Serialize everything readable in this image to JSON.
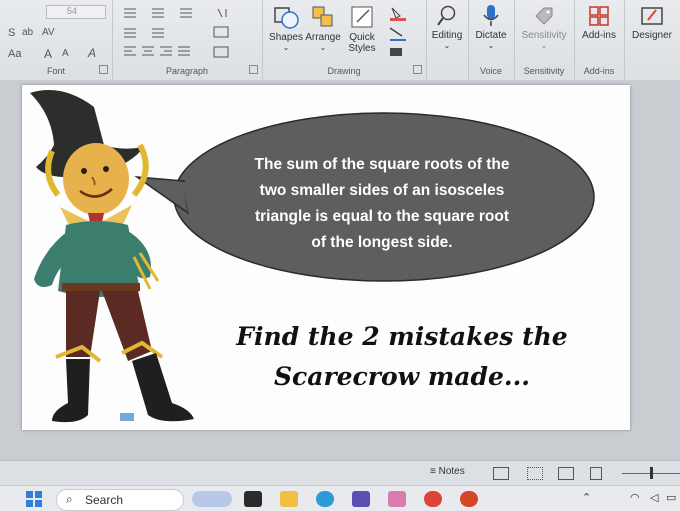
{
  "ribbon": {
    "font_group": {
      "label": "Font",
      "size": "54",
      "style_hint": "Aa",
      "grow": "A",
      "shrink": "A"
    },
    "paragraph_group": {
      "label": "Paragraph"
    },
    "drawing_group": {
      "label": "Drawing",
      "shapes": "Shapes",
      "arrange": "Arrange",
      "quick_styles_line1": "Quick",
      "quick_styles_line2": "Styles"
    },
    "editing": {
      "label": "Editing"
    },
    "voice_group": {
      "label": "Voice",
      "dictate": "Dictate"
    },
    "sensitivity_group": {
      "label": "Sensitivity",
      "button": "Sensitivity"
    },
    "addins_group": {
      "label": "Add-ins",
      "button": "Add-ins"
    },
    "designer": {
      "label": "Designer"
    }
  },
  "slide": {
    "bubble_line1": "The sum of the square roots of the",
    "bubble_line2": "two smaller sides of an isosceles",
    "bubble_line3": "triangle is equal to the square root",
    "bubble_line4": "of the longest side.",
    "headline_line1": "Find the 2 mistakes the",
    "headline_line2": "Scarecrow made..."
  },
  "status_bar": {
    "notes": "Notes"
  },
  "taskbar": {
    "search": "Search"
  },
  "colors": {
    "bubble": "#5e5e5e",
    "ribbon": "#e6e8eb",
    "accent": "#d24726"
  }
}
